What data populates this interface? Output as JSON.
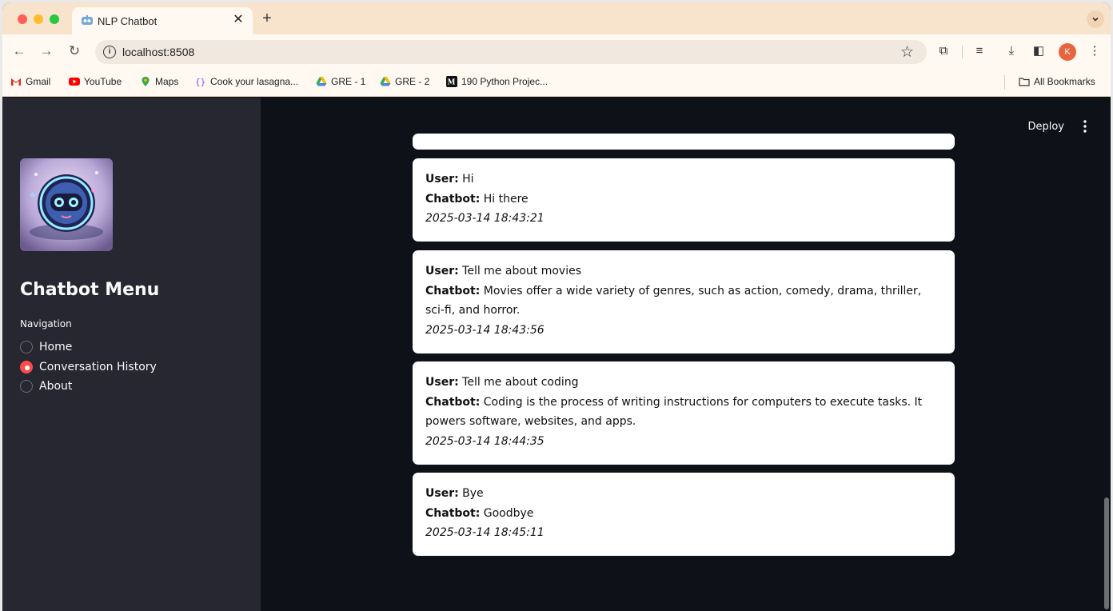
{
  "browser": {
    "tab_title": "NLP Chatbot",
    "tab_close": "✕",
    "new_tab": "+",
    "url": "localhost:8508",
    "profile_initial": "K",
    "bookmarks": [
      {
        "label": "Gmail",
        "icon": "gmail-icon"
      },
      {
        "label": "YouTube",
        "icon": "youtube-icon"
      },
      {
        "label": "Maps",
        "icon": "maps-icon"
      },
      {
        "label": "Cook your lasagna...",
        "icon": "bracket-icon"
      },
      {
        "label": "GRE - 1",
        "icon": "drive-icon"
      },
      {
        "label": "GRE - 2",
        "icon": "drive-icon"
      },
      {
        "label": "190 Python Projec...",
        "icon": "medium-icon"
      }
    ],
    "all_bookmarks": "All Bookmarks"
  },
  "sidebar": {
    "title": "Chatbot Menu",
    "nav_label": "Navigation",
    "options": [
      {
        "label": "Home",
        "selected": false
      },
      {
        "label": "Conversation History",
        "selected": true
      },
      {
        "label": "About",
        "selected": false
      }
    ]
  },
  "header": {
    "deploy_label": "Deploy"
  },
  "conversations": [
    {
      "user_label": "User:",
      "user": " Hi",
      "bot_label": "Chatbot:",
      "bot": " Hi there",
      "time": "2025-03-14 18:43:21"
    },
    {
      "user_label": "User:",
      "user": " Tell me about movies",
      "bot_label": "Chatbot:",
      "bot": " Movies offer a wide variety of genres, such as action, comedy, drama, thriller, sci-fi, and horror.",
      "time": "2025-03-14 18:43:56"
    },
    {
      "user_label": "User:",
      "user": " Tell me about coding",
      "bot_label": "Chatbot:",
      "bot": " Coding is the process of writing instructions for computers to execute tasks. It powers software, websites, and apps.",
      "time": "2025-03-14 18:44:35"
    },
    {
      "user_label": "User:",
      "user": " Bye",
      "bot_label": "Chatbot:",
      "bot": " Goodbye",
      "time": "2025-03-14 18:45:11"
    }
  ],
  "colors": {
    "accent": "#ff4b4b",
    "sidebar_bg": "#262730",
    "main_bg": "#0e1117"
  }
}
